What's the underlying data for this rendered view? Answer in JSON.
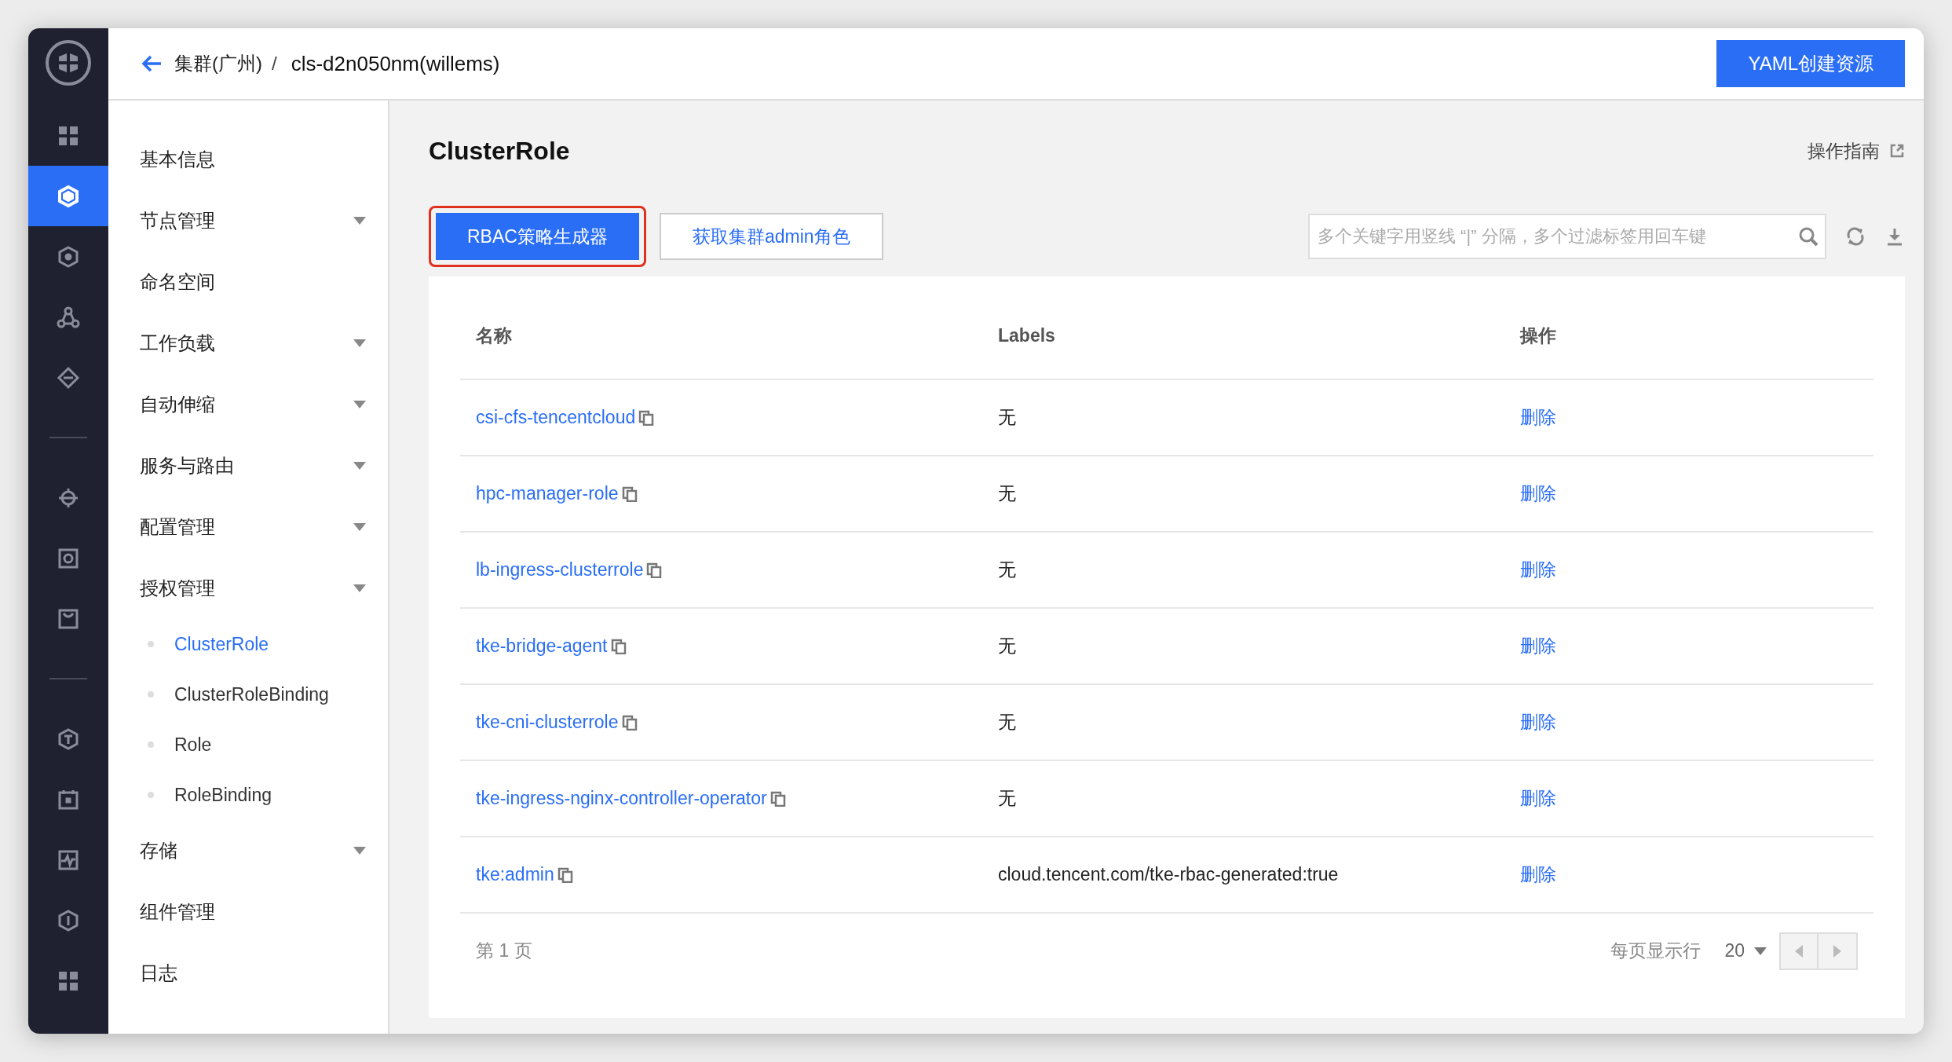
{
  "rail": {
    "groups": [
      [
        {
          "selected": false
        },
        {
          "selected": true
        },
        {
          "selected": false
        },
        {
          "selected": false
        },
        {
          "selected": false
        }
      ],
      [
        {
          "selected": false
        },
        {
          "selected": false
        },
        {
          "selected": false
        }
      ],
      [
        {
          "selected": false
        },
        {
          "selected": false
        },
        {
          "selected": false
        },
        {
          "selected": false
        },
        {
          "selected": false
        }
      ]
    ]
  },
  "header": {
    "back": "集群(广州)",
    "separator": "/",
    "cluster": "cls-d2n050nm(willems)",
    "button": "YAML创建资源"
  },
  "menu": [
    {
      "label": "基本信息",
      "expandable": false
    },
    {
      "label": "节点管理",
      "expandable": true
    },
    {
      "label": "命名空间",
      "expandable": false
    },
    {
      "label": "工作负载",
      "expandable": true
    },
    {
      "label": "自动伸缩",
      "expandable": true
    },
    {
      "label": "服务与路由",
      "expandable": true
    },
    {
      "label": "配置管理",
      "expandable": true
    },
    {
      "label": "授权管理",
      "expandable": true,
      "children": [
        {
          "label": "ClusterRole",
          "selected": true
        },
        {
          "label": "ClusterRoleBinding",
          "selected": false
        },
        {
          "label": "Role",
          "selected": false
        },
        {
          "label": "RoleBinding",
          "selected": false
        }
      ]
    },
    {
      "label": "存储",
      "expandable": true
    },
    {
      "label": "组件管理",
      "expandable": false
    },
    {
      "label": "日志",
      "expandable": false
    }
  ],
  "page": {
    "title": "ClusterRole",
    "guide": "操作指南"
  },
  "toolbar": {
    "buttons": [
      {
        "label": "RBAC策略生成器",
        "kind": "primary",
        "highlighted": true
      },
      {
        "label": "获取集群admin角色",
        "kind": "default",
        "highlighted": false
      }
    ],
    "search": {
      "placeholder": "多个关键字用竖线 “|” 分隔，多个过滤标签用回车键"
    }
  },
  "table": {
    "columns": [
      "名称",
      "Labels",
      "操作"
    ],
    "rows": [
      {
        "name": "csi-cfs-tencentcloud",
        "labels": "无",
        "action": "删除"
      },
      {
        "name": "hpc-manager-role",
        "labels": "无",
        "action": "删除"
      },
      {
        "name": "lb-ingress-clusterrole",
        "labels": "无",
        "action": "删除"
      },
      {
        "name": "tke-bridge-agent",
        "labels": "无",
        "action": "删除"
      },
      {
        "name": "tke-cni-clusterrole",
        "labels": "无",
        "action": "删除"
      },
      {
        "name": "tke-ingress-nginx-controller-operator",
        "labels": "无",
        "action": "删除"
      },
      {
        "name": "tke:admin",
        "labels": "cloud.tencent.com/tke-rbac-generated:true",
        "action": "删除"
      }
    ]
  },
  "pagination": {
    "page": "第 1 页",
    "per_page_label": "每页显示行",
    "per_page": "20",
    "prev_disabled": true,
    "next_disabled": true
  }
}
